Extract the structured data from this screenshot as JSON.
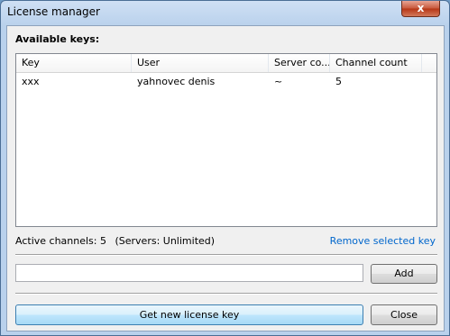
{
  "window": {
    "title": "License manager",
    "close_glyph": "x"
  },
  "heading": "Available keys:",
  "table": {
    "columns": [
      "Key",
      "User",
      "Server co...",
      "Channel count"
    ],
    "rows": [
      {
        "key": "xxx",
        "user": "yahnovec denis",
        "servers": "~",
        "channels": "5"
      }
    ]
  },
  "status": {
    "active_channels": "Active channels: 5",
    "servers": "(Servers: Unlimited)"
  },
  "remove_link": "Remove selected key",
  "key_input": {
    "value": "",
    "placeholder": ""
  },
  "buttons": {
    "add": "Add",
    "get_key": "Get new license key",
    "close": "Close"
  },
  "colors": {
    "link": "#0066cc",
    "default_button_border": "#3c7fb1"
  }
}
